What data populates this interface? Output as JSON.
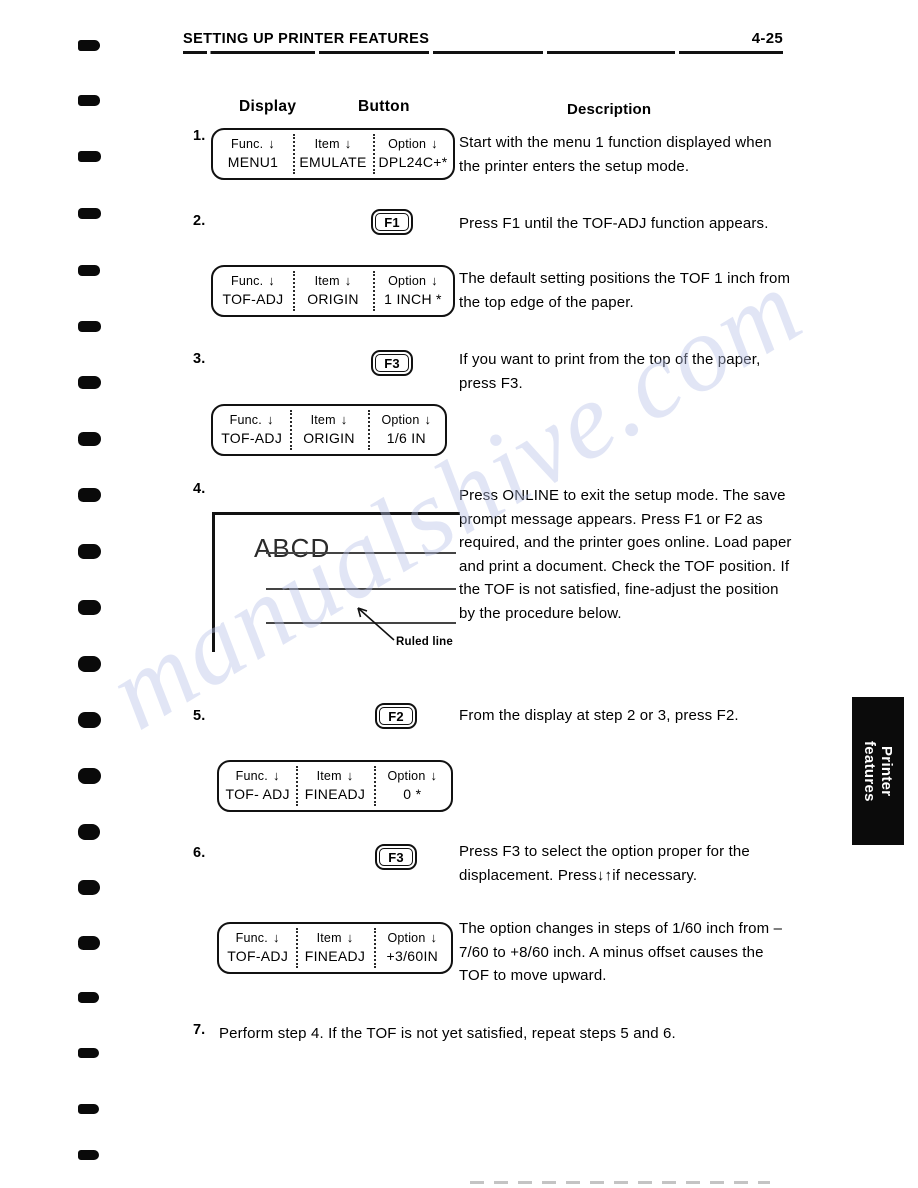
{
  "header": {
    "title": "SETTING UP PRINTER FEATURES",
    "page_number": "4-25"
  },
  "columns": {
    "display": "Display",
    "button": "Button",
    "description": "Description"
  },
  "side_tab": {
    "label": "Printer\nfeatures"
  },
  "lcd_labels": {
    "func": "Func.",
    "item": "Item",
    "option": "Option",
    "arrow": "↓"
  },
  "steps": [
    {
      "number": "1.",
      "display": {
        "func": "MENU1",
        "item": "EMULATE",
        "option": "DPL24C+*"
      },
      "button": null,
      "description": "Start with the menu 1 function displayed when the printer enters the setup mode."
    },
    {
      "number": "2.",
      "button": "F1",
      "description": "Press F1 until the TOF-ADJ function appears.",
      "display": {
        "func": "TOF-ADJ",
        "item": "ORIGIN",
        "option": "1 INCH *"
      },
      "display_description": "The default setting positions the TOF 1 inch from the top edge of the paper."
    },
    {
      "number": "3.",
      "button": "F3",
      "description": "If you want to print from the top of the paper, press F3.",
      "display": {
        "func": "TOF-ADJ",
        "item": "ORIGIN",
        "option": "1/6 IN"
      }
    },
    {
      "number": "4.",
      "description": "Press ONLINE to exit the setup mode. The save prompt message appears. Press F1 or F2 as required, and the printer goes online. Load paper and print a document. Check the TOF position. If the TOF is not satisfied, fine-adjust the position by the procedure below.",
      "illustration": {
        "sample_text": "ABCD",
        "callout": "Ruled line"
      }
    },
    {
      "number": "5.",
      "button": "F2",
      "description": "From the display at step 2 or 3, press F2.",
      "display": {
        "func": "TOF- ADJ",
        "item": "FINEADJ",
        "option": "0 *"
      }
    },
    {
      "number": "6.",
      "button": "F3",
      "description": "Press F3 to select the option proper for the displacement. Press↓↑if necessary.",
      "display": {
        "func": "TOF-ADJ",
        "item": "FINEADJ",
        "option": "+3/60IN"
      },
      "display_description": "The option changes in steps of 1/60 inch from – 7/60 to +8/60 inch. A minus offset causes the TOF to move upward."
    },
    {
      "number": "7.",
      "description": "Perform step 4. If the TOF is not yet satisfied, repeat steps 5 and 6."
    }
  ],
  "watermark": {
    "text": "manualshive.com"
  }
}
